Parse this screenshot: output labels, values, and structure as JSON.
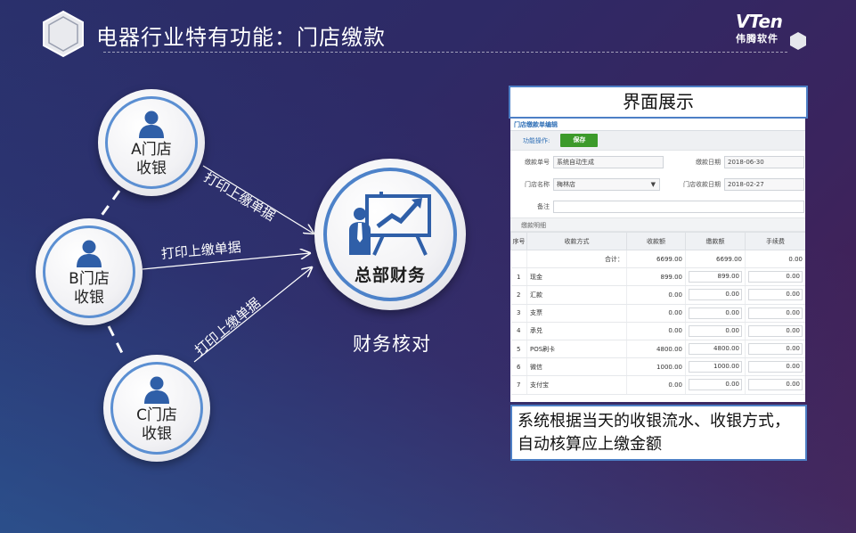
{
  "header": {
    "title": "电器行业特有功能：门店缴款",
    "brand_mark": "VTen",
    "brand_sub": "伟腾软件"
  },
  "diagram": {
    "stores": [
      {
        "label_1": "A门店",
        "label_2": "收银"
      },
      {
        "label_1": "B门店",
        "label_2": "收银"
      },
      {
        "label_1": "C门店",
        "label_2": "收银"
      }
    ],
    "edge_label": "打印上缴单据",
    "hq_label": "总部财务",
    "verify_label": "财务核对"
  },
  "panel": {
    "title": "界面展示",
    "description": "系统根据当天的收银流水、收银方式，自动核算应上缴金额"
  },
  "screen": {
    "heading": "门店缴款单编辑",
    "ops_label": "功能操作:",
    "save_label": "保存",
    "fields": {
      "order_no_label": "缴款单号",
      "order_no_value": "系统自动生成",
      "pay_date_label": "缴款日期",
      "pay_date_value": "2018-06-30",
      "store_label": "门店名称",
      "store_value": "梅林店",
      "receipt_date_label": "门店收款日期",
      "receipt_date_value": "2018-02-27",
      "remark_label": "备注"
    },
    "section_label": "缴款明细",
    "columns": [
      "序号",
      "收款方式",
      "收款额",
      "缴款额",
      "手续费"
    ],
    "total": {
      "label": "合计：",
      "received": "6699.00",
      "paid": "6699.00",
      "fee": "0.00"
    },
    "rows": [
      {
        "idx": "1",
        "method": "现金",
        "received": "899.00",
        "paid": "899.00",
        "fee": "0.00"
      },
      {
        "idx": "2",
        "method": "汇款",
        "received": "0.00",
        "paid": "0.00",
        "fee": "0.00"
      },
      {
        "idx": "3",
        "method": "支票",
        "received": "0.00",
        "paid": "0.00",
        "fee": "0.00"
      },
      {
        "idx": "4",
        "method": "承兑",
        "received": "0.00",
        "paid": "0.00",
        "fee": "0.00"
      },
      {
        "idx": "5",
        "method": "POS刷卡",
        "received": "4800.00",
        "paid": "4800.00",
        "fee": "0.00"
      },
      {
        "idx": "6",
        "method": "微信",
        "received": "1000.00",
        "paid": "1000.00",
        "fee": "0.00"
      },
      {
        "idx": "7",
        "method": "支付宝",
        "received": "0.00",
        "paid": "0.00",
        "fee": "0.00"
      }
    ]
  },
  "colors": {
    "ring_blue": "#5b8fd2",
    "save_green": "#3c9a2b",
    "link_blue": "#2f6fb6"
  }
}
